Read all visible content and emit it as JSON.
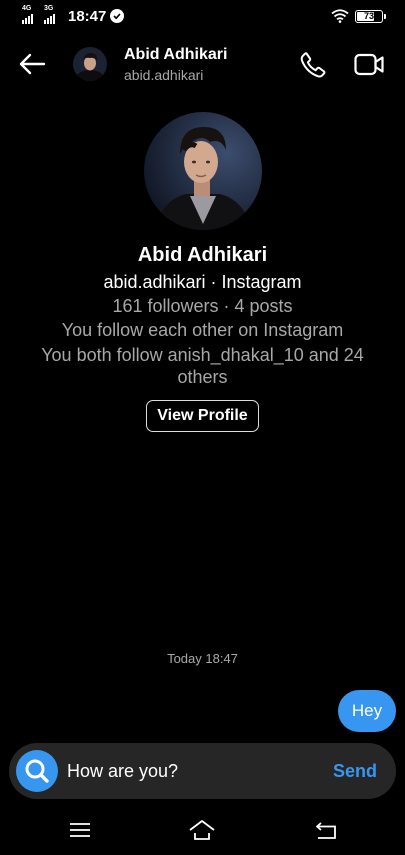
{
  "status_bar": {
    "network_1": "4G",
    "network_2": "3G",
    "time": "18:47",
    "battery": "73",
    "battery_level": 0.73
  },
  "header": {
    "name": "Abid Adhikari",
    "username": "abid.adhikari",
    "icons": {
      "back": "arrow-left-icon",
      "call": "phone-icon",
      "video": "video-camera-icon"
    }
  },
  "profile": {
    "name": "Abid Adhikari",
    "username_line": "abid.adhikari · Instagram",
    "stats": "161 followers · 4 posts",
    "mutual": "You follow each other on Instagram",
    "common_follow": "You both follow anish_dhakal_10 and 24 others",
    "view_button": "View Profile"
  },
  "chat": {
    "timestamp": "Today 18:47",
    "messages": [
      {
        "from": "me",
        "text": "Hey"
      }
    ]
  },
  "composer": {
    "value": "How are you?",
    "send_label": "Send"
  },
  "colors": {
    "accent": "#3797f0",
    "background": "#000000",
    "composer_bg": "#262626",
    "secondary_text": "#a8a8a8"
  }
}
